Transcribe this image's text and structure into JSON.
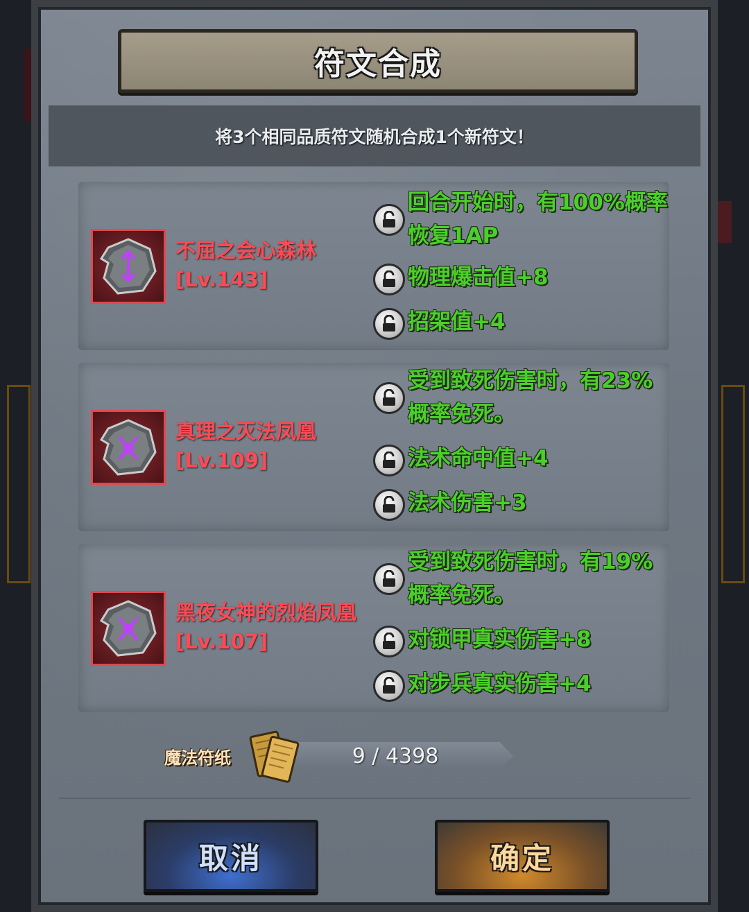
{
  "dialog": {
    "title": "符文合成",
    "subtitle": "将3个相同品质符文随机合成1个新符文！"
  },
  "runes": [
    {
      "name": "不屈之会心森林",
      "level": "[Lv.143]",
      "attributes": [
        "回合开始时，有100%概率恢复1AP",
        "物理爆击值+8",
        "招架值+4"
      ]
    },
    {
      "name": "真理之灭法凤凰",
      "level": "[Lv.109]",
      "attributes": [
        "受到致死伤害时，有23%概率免死。",
        "法术命中值+4",
        "法术伤害+3"
      ]
    },
    {
      "name": "黑夜女神的烈焰凤凰",
      "level": "[Lv.107]",
      "attributes": [
        "受到致死伤害时，有19%概率免死。",
        "对锁甲真实伤害+8",
        "对步兵真实伤害+4"
      ]
    }
  ],
  "magic_paper": {
    "label": "魔法符纸",
    "count": "9 / 4398"
  },
  "buttons": {
    "cancel": "取消",
    "confirm": "确定"
  },
  "colors": {
    "rune_name": "#ff4a55",
    "attribute": "#4ad02a",
    "rune_glow": "#c040ff"
  },
  "icons": {
    "lock": "unlock-icon",
    "rune": "rune-stone-icon",
    "paper": "magic-paper-icon"
  }
}
